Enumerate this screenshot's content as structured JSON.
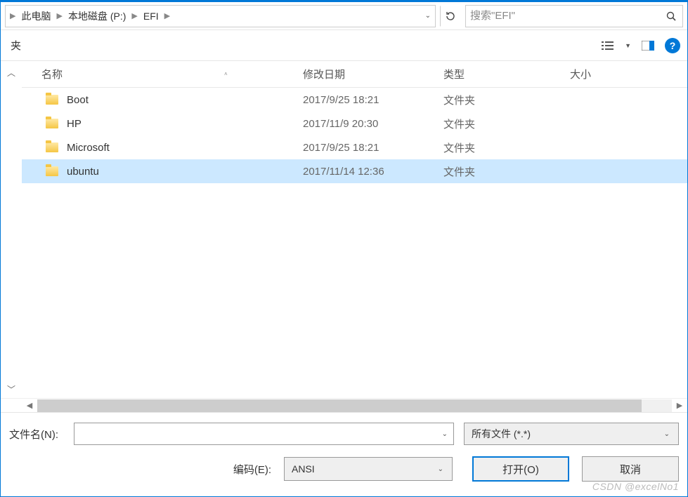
{
  "breadcrumb": {
    "items": [
      "此电脑",
      "本地磁盘 (P:)",
      "EFI"
    ]
  },
  "search": {
    "placeholder": "搜索\"EFI\""
  },
  "toolbar": {
    "left_label": "夹"
  },
  "columns": {
    "name": "名称",
    "date": "修改日期",
    "type": "类型",
    "size": "大小"
  },
  "rows": [
    {
      "name": "Boot",
      "date": "2017/9/25 18:21",
      "type": "文件夹",
      "selected": false
    },
    {
      "name": "HP",
      "date": "2017/11/9 20:30",
      "type": "文件夹",
      "selected": false
    },
    {
      "name": "Microsoft",
      "date": "2017/9/25 18:21",
      "type": "文件夹",
      "selected": false
    },
    {
      "name": "ubuntu",
      "date": "2017/11/14 12:36",
      "type": "文件夹",
      "selected": true
    }
  ],
  "footer": {
    "filename_label": "文件名(N):",
    "filename_value": "",
    "filter_label": "所有文件 (*.*)",
    "encoding_label": "编码(E):",
    "encoding_value": "ANSI",
    "open_label": "打开(O)",
    "cancel_label": "取消"
  },
  "watermark": "CSDN @excelNo1"
}
